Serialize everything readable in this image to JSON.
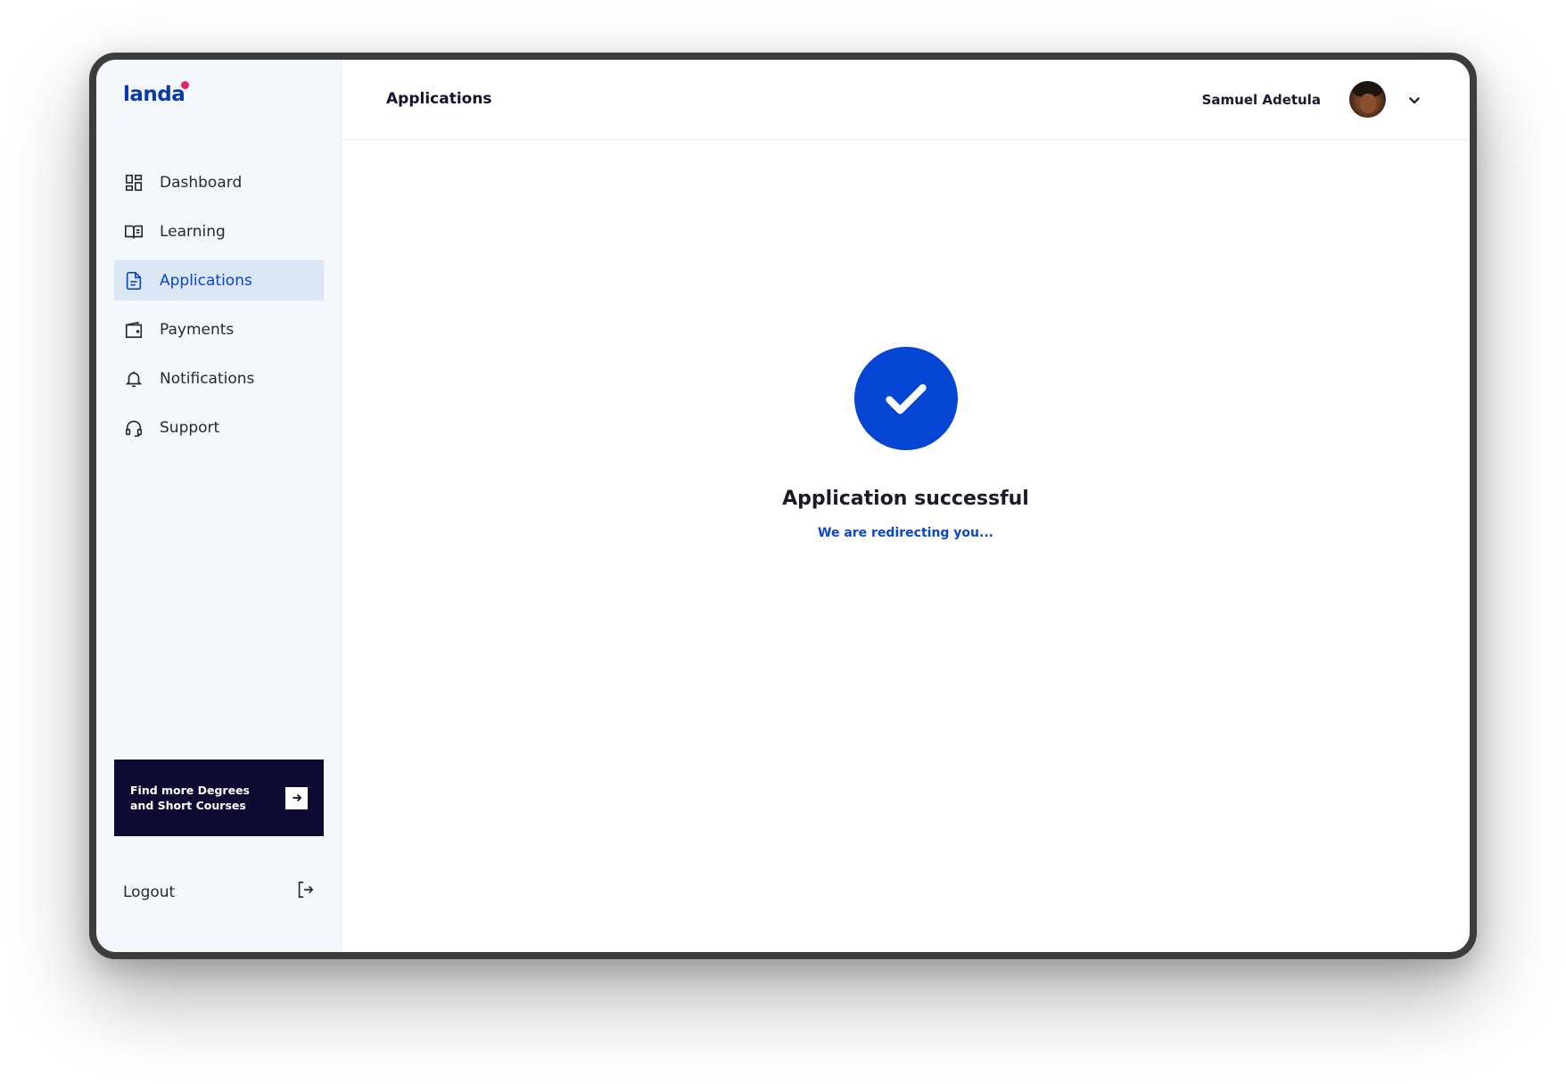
{
  "brand": {
    "logo_text": "landa"
  },
  "sidebar": {
    "items": [
      {
        "label": "Dashboard",
        "icon": "dashboard-icon"
      },
      {
        "label": "Learning",
        "icon": "book-open-icon"
      },
      {
        "label": "Applications",
        "icon": "document-icon",
        "active": true
      },
      {
        "label": "Payments",
        "icon": "wallet-icon"
      },
      {
        "label": "Notifications",
        "icon": "bell-icon"
      },
      {
        "label": "Support",
        "icon": "headset-icon"
      }
    ],
    "promo": {
      "text": "Find more Degrees and Short Courses",
      "icon": "arrow-right-icon"
    },
    "logout": {
      "label": "Logout",
      "icon": "logout-icon"
    }
  },
  "header": {
    "title": "Applications",
    "user_name": "Samuel Adetula",
    "menu_icon": "chevron-down-icon"
  },
  "status": {
    "title": "Application successful",
    "subtitle": "We are redirecting you...",
    "icon": "check-icon"
  },
  "colors": {
    "accent": "#0545d3",
    "sidebar_bg": "#f4f8fc",
    "active_bg": "#dce7f6",
    "promo_bg": "#0e0a32",
    "logo_dot": "#e8245c"
  }
}
